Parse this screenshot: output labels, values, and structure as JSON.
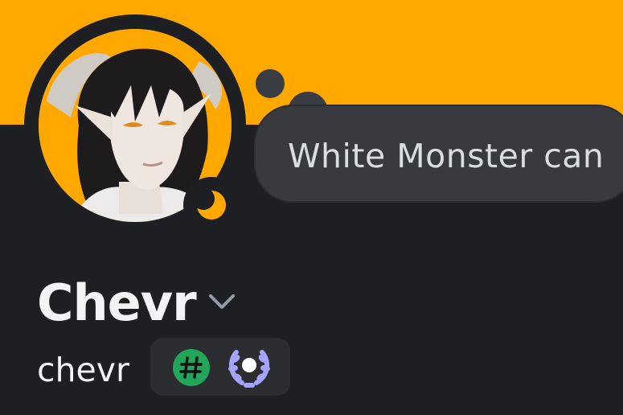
{
  "profile": {
    "display_name": "Chevr",
    "username": "chevr",
    "custom_status": "White Monster can",
    "banner_color": "#ffa800",
    "status": "idle",
    "status_icon": "moon-icon",
    "badges": [
      {
        "name": "hash-badge",
        "icon": "hash-icon",
        "color": "#23a55a"
      },
      {
        "name": "laurel-badge",
        "icon": "laurel-icon",
        "color": "#a4a5ff"
      }
    ]
  }
}
